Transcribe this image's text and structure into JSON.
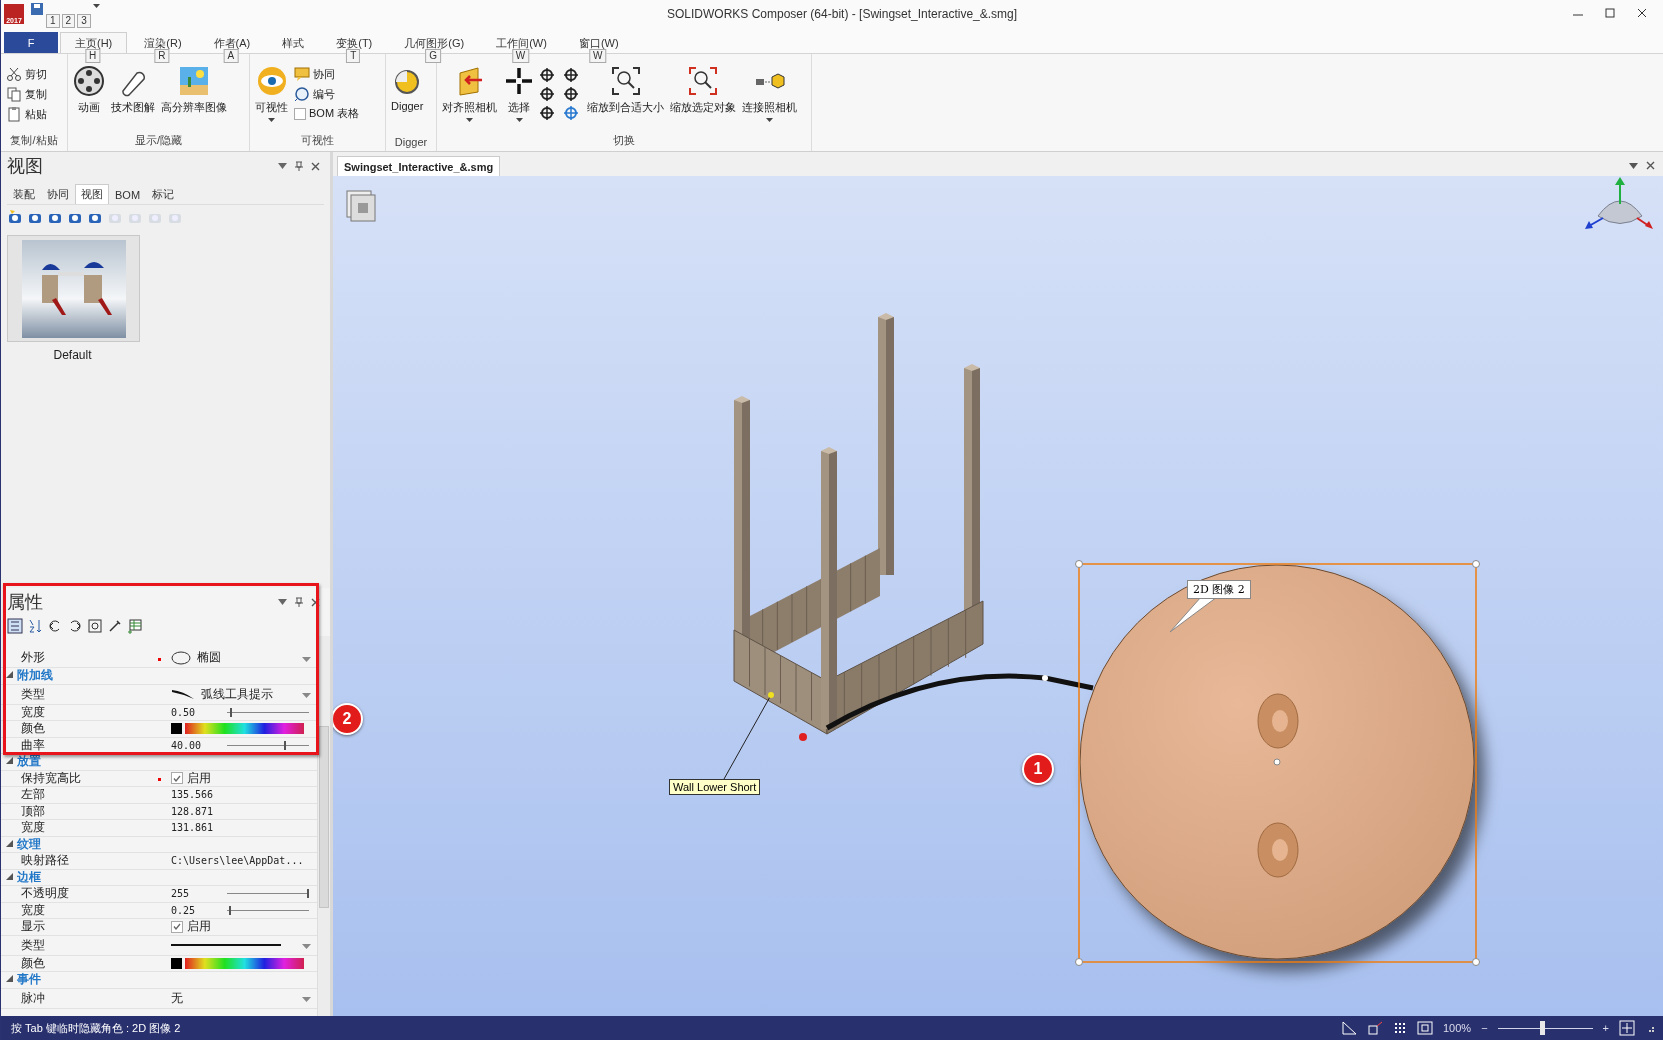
{
  "window": {
    "title": "SOLIDWORKS Composer (64-bit) - [Swingset_Interactive_&.smg]",
    "app_icon_text": "2017"
  },
  "quick_access_keytips": [
    "1",
    "2",
    "3"
  ],
  "ribbon": {
    "file_tab": "F",
    "tabs": [
      {
        "label": "主页(H)",
        "keytip": "H",
        "selected": true
      },
      {
        "label": "渲染(R)",
        "keytip": "R",
        "selected": false
      },
      {
        "label": "作者(A)",
        "keytip": "A",
        "selected": false
      },
      {
        "label": "样式",
        "selected": false
      },
      {
        "label": "变换(T)",
        "keytip": "T",
        "selected": false
      },
      {
        "label": "几何图形(G)",
        "keytip": "G",
        "selected": false
      },
      {
        "label": "工作间(W)",
        "keytip": "W",
        "selected": false
      },
      {
        "label": "窗口(W)",
        "keytip": "W",
        "selected": false
      }
    ],
    "groups": [
      {
        "label": "复制/粘贴",
        "items": [
          {
            "kind": "small",
            "label": "剪切"
          },
          {
            "kind": "small",
            "label": "复制"
          },
          {
            "kind": "small",
            "label": "粘贴"
          }
        ]
      },
      {
        "label": "显示/隐藏",
        "items": [
          {
            "kind": "large",
            "label": "动画",
            "dropdown": false
          },
          {
            "kind": "large",
            "label": "技术图解",
            "dropdown": false
          },
          {
            "kind": "large",
            "label": "高分辨率图像",
            "dropdown": false
          }
        ]
      },
      {
        "label": "可视性",
        "items": [
          {
            "kind": "large",
            "label": "可视性",
            "dropdown": true
          },
          {
            "kind": "small",
            "label": "协同"
          },
          {
            "kind": "small",
            "label": "编号"
          },
          {
            "kind": "check",
            "label": "BOM 表格",
            "checked": false
          }
        ]
      },
      {
        "label": "Digger",
        "items": [
          {
            "kind": "large",
            "label": "Digger",
            "dropdown": false
          }
        ]
      },
      {
        "label": "切换",
        "items": [
          {
            "kind": "large",
            "label": "对齐照相机",
            "dropdown": true
          },
          {
            "kind": "large",
            "label": "选择",
            "dropdown": true
          },
          {
            "kind": "nav"
          },
          {
            "kind": "large",
            "label": "缩放到合适大小",
            "dropdown": false
          },
          {
            "kind": "large",
            "label": "缩放选定对象",
            "dropdown": false
          },
          {
            "kind": "large",
            "label": "连接照相机",
            "dropdown": true
          }
        ]
      }
    ]
  },
  "views_panel": {
    "title": "视图",
    "tabs": [
      {
        "label": "装配",
        "selected": false
      },
      {
        "label": "协同",
        "selected": false
      },
      {
        "label": "视图",
        "selected": true
      },
      {
        "label": "BOM",
        "selected": false
      },
      {
        "label": "标记",
        "selected": false
      }
    ],
    "toolbar": [
      {
        "disabled": false
      },
      {
        "disabled": false
      },
      {
        "disabled": false
      },
      {
        "disabled": false
      },
      {
        "disabled": false
      },
      {
        "disabled": true
      },
      {
        "disabled": true
      },
      {
        "disabled": true
      },
      {
        "disabled": true
      }
    ],
    "views": [
      {
        "label": "Default",
        "kind": "picture"
      }
    ]
  },
  "properties_panel": {
    "title": "属性",
    "rows": [
      {
        "kind": "dropdown",
        "label": "外形",
        "value": "椭圆",
        "modified": true
      },
      {
        "kind": "category",
        "label": "附加线",
        "expanded": true
      },
      {
        "kind": "dropdown",
        "label": "类型",
        "value": "弧线工具提示",
        "modified": false
      },
      {
        "kind": "slider",
        "label": "宽度",
        "value": "0.50",
        "level": 0.04,
        "modified": false
      },
      {
        "kind": "color",
        "label": "颜色",
        "color": "#000000",
        "modified": false
      },
      {
        "kind": "slider",
        "label": "曲率",
        "value": "40.00",
        "level": 0.69,
        "modified": false
      },
      {
        "kind": "category",
        "label": "放置",
        "expanded": true
      },
      {
        "kind": "checkbox",
        "label": "保持宽高比",
        "value": "启用",
        "checked": true,
        "modified": true
      },
      {
        "kind": "text",
        "label": "左部",
        "value": "135.566",
        "modified": false
      },
      {
        "kind": "text",
        "label": "顶部",
        "value": "128.871",
        "modified": false
      },
      {
        "kind": "text",
        "label": "宽度",
        "value": "131.861",
        "modified": false
      },
      {
        "kind": "category",
        "label": "纹理",
        "expanded": true
      },
      {
        "kind": "text",
        "label": "映射路径",
        "value": "C:\\Users\\lee\\AppDat...",
        "modified": false
      },
      {
        "kind": "category",
        "label": "边框",
        "expanded": true
      },
      {
        "kind": "slider",
        "label": "不透明度",
        "value": "255",
        "level": 0.98,
        "modified": false
      },
      {
        "kind": "slider",
        "label": "宽度",
        "value": "0.25",
        "level": 0.02,
        "modified": false
      },
      {
        "kind": "checkbox",
        "label": "显示",
        "value": "启用",
        "checked": true,
        "modified": false
      },
      {
        "kind": "line",
        "label": "类型",
        "modified": false
      },
      {
        "kind": "color",
        "label": "颜色",
        "color": "#000000",
        "modified": false
      },
      {
        "kind": "category",
        "label": "事件",
        "expanded": true
      },
      {
        "kind": "dropdown",
        "label": "脉冲",
        "value": "无",
        "modified": false
      }
    ]
  },
  "document": {
    "tab": "Swingset_Interactive_&.smg",
    "part_label": "Wall Lower Short",
    "callout": "2D 图像 2",
    "markers": [
      "1",
      "2"
    ]
  },
  "status_bar": {
    "message": "按 Tab 键临时隐藏角色 : 2D 图像 2",
    "zoom": {
      "reading": "100%",
      "level": 0.45,
      "minus": "−",
      "plus": "+"
    }
  }
}
